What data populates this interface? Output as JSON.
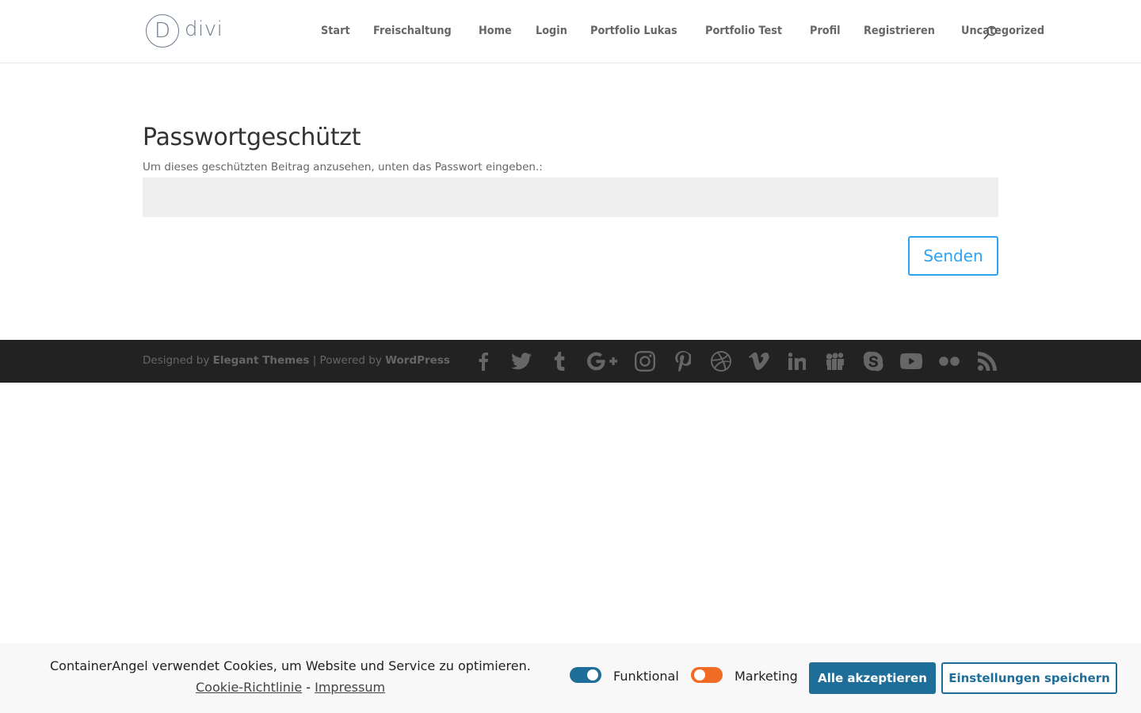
{
  "header": {
    "logo_text": "divi",
    "logo_letter": "D",
    "nav": [
      "Start",
      "Freischaltung",
      "Home",
      "Login",
      "Portfolio Lukas",
      "Portfolio Test",
      "Profil",
      "Registrieren",
      "Uncategorized"
    ]
  },
  "main": {
    "title": "Passwortgeschützt",
    "description": "Um dieses geschützten Beitrag anzusehen, unten das Passwort eingeben.:",
    "password_value": "",
    "submit_label": "Senden"
  },
  "footer": {
    "designed_by": "Designed by",
    "elegant": "Elegant Themes",
    "separator": "| Powered by",
    "wordpress": "WordPress",
    "social_icons": [
      "facebook-icon",
      "twitter-icon",
      "tumblr-icon",
      "google-plus-icon",
      "instagram-icon",
      "pinterest-icon",
      "dribbble-icon",
      "vimeo-icon",
      "linkedin-icon",
      "myspace-icon",
      "skype-icon",
      "youtube-icon",
      "flickr-icon",
      "rss-icon"
    ]
  },
  "cookie": {
    "text": "ContainerAngel verwendet Cookies, um Website und Service zu optimieren.",
    "policy_link": "Cookie-Richtlinie",
    "dash": " - ",
    "imprint_link": "Impressum",
    "toggle_functional": "Funktional",
    "toggle_marketing": "Marketing",
    "accept_all": "Alle akzeptieren",
    "save_settings": "Einstellungen speichern",
    "colors": {
      "functional_on": "#1e6e99",
      "marketing_off": "#f06b23"
    }
  }
}
